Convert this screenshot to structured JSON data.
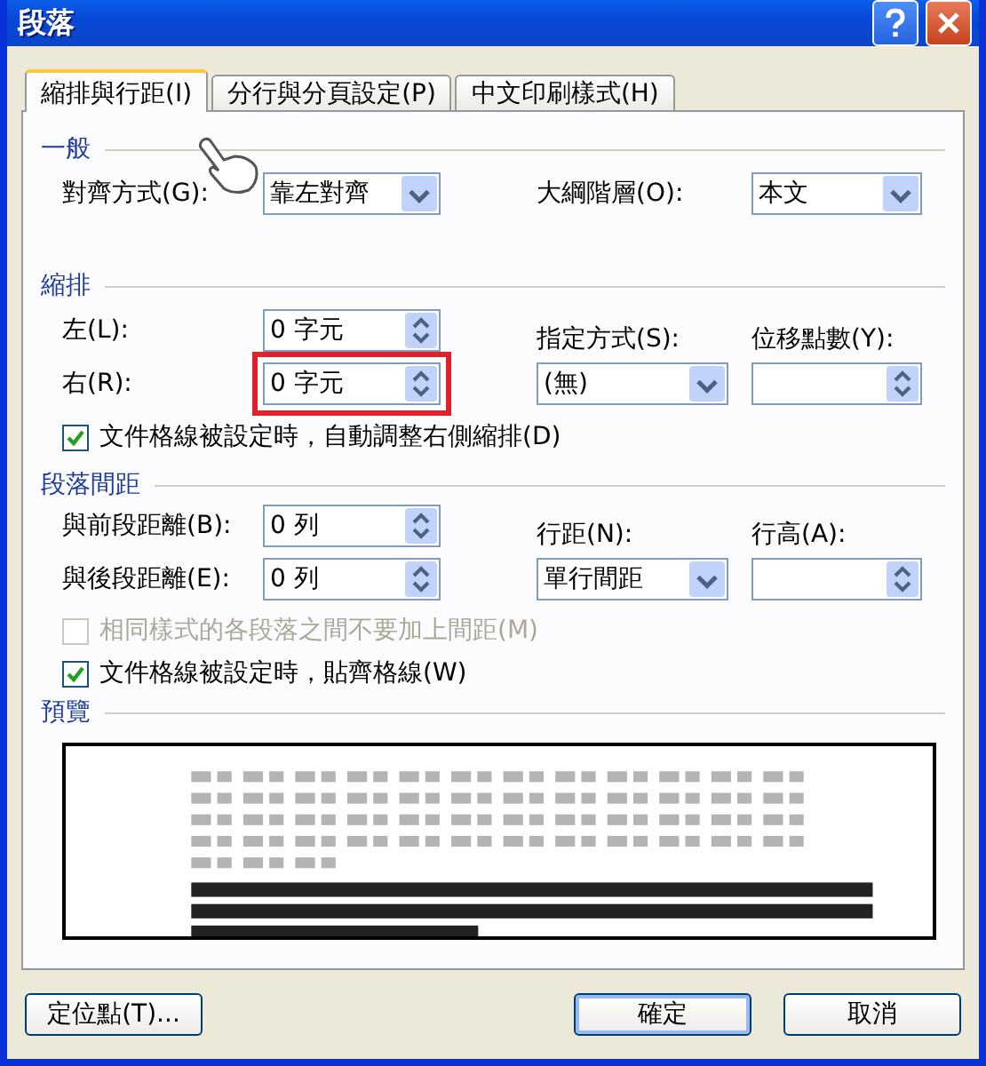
{
  "window": {
    "title": "段落"
  },
  "tabs": [
    {
      "label": "縮排與行距(I)",
      "selected": true
    },
    {
      "label": "分行與分頁設定(P)",
      "selected": false
    },
    {
      "label": "中文印刷樣式(H)",
      "selected": false
    }
  ],
  "general": {
    "heading": "一般",
    "alignment": {
      "label": "對齊方式(G):",
      "value": "靠左對齊"
    },
    "outline_level": {
      "label": "大綱階層(O):",
      "value": "本文"
    }
  },
  "indentation": {
    "heading": "縮排",
    "left": {
      "label": "左(L):",
      "value": "0 字元",
      "highlighted": false
    },
    "right": {
      "label": "右(R):",
      "value": "0 字元",
      "highlighted": true
    },
    "special": {
      "label": "指定方式(S):",
      "value": "(無)"
    },
    "by": {
      "label": "位移點數(Y):"
    },
    "auto_adjust": {
      "label": "文件格線被設定時，自動調整右側縮排(D)",
      "checked": true,
      "disabled": false
    }
  },
  "spacing": {
    "heading": "段落間距",
    "before": {
      "label": "與前段距離(B):",
      "value": "0 列",
      "highlighted": false
    },
    "after": {
      "label": "與後段距離(E):",
      "value": "0 列",
      "highlighted": false
    },
    "line_spacing": {
      "label": "行距(N):",
      "value": "單行間距"
    },
    "at": {
      "label": "行高(A):"
    },
    "options": [
      {
        "label": "相同樣式的各段落之間不要加上間距(M)",
        "checked": false,
        "disabled": true
      },
      {
        "label": "文件格線被設定時，貼齊格線(W)",
        "checked": true,
        "disabled": false
      }
    ]
  },
  "preview": {
    "heading": "預覽"
  },
  "buttons": [
    {
      "label": "定位點(T)...",
      "default": false
    },
    {
      "label": "確定",
      "default": true
    },
    {
      "label": "取消",
      "default": false
    }
  ]
}
